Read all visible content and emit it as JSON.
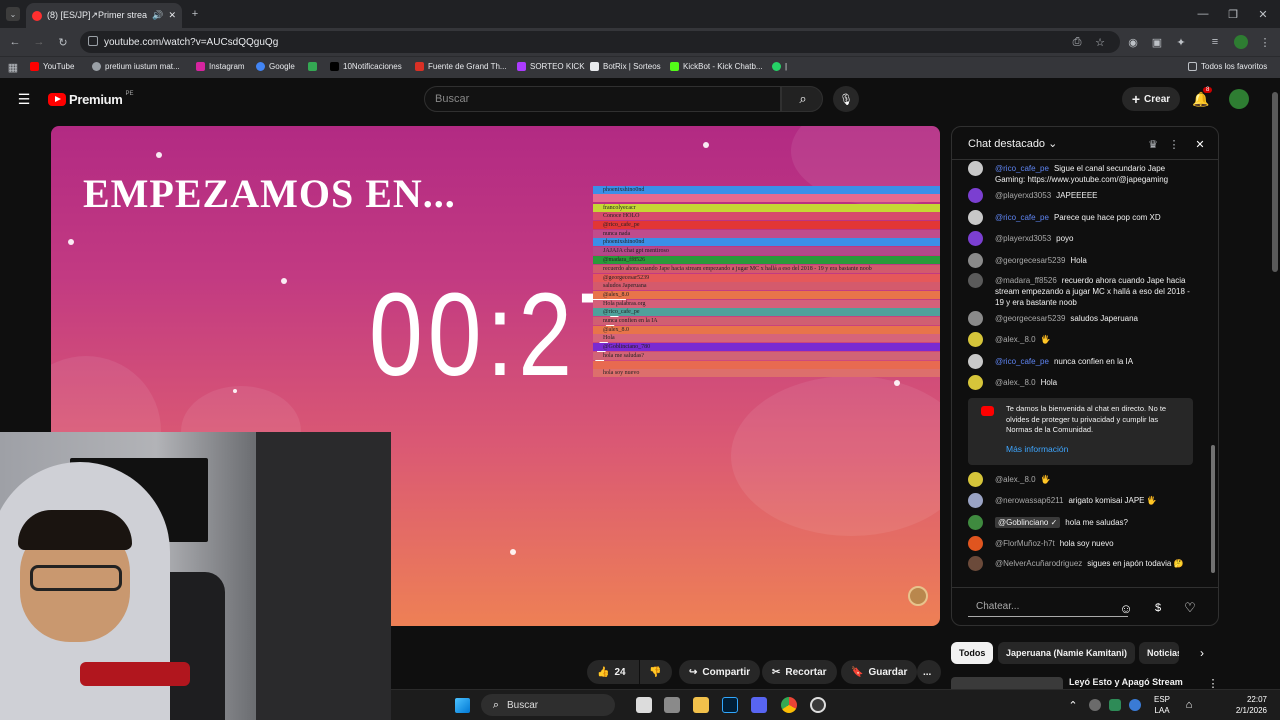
{
  "browser": {
    "tab_title": "(8) [ES/JP]↗Primer stream",
    "url": "youtube.com/watch?v=AUCsdQQguQg",
    "bookmarks": [
      {
        "label": "YouTube",
        "color": "#ff0000"
      },
      {
        "label": "pretium iustum mat...",
        "color": "#9aa0a6"
      },
      {
        "label": "Instagram",
        "color": "#d6249f"
      },
      {
        "label": "Google",
        "color": "#4285f4"
      },
      {
        "label": "",
        "color": "#34a853"
      },
      {
        "label": "10Notificaciones",
        "color": "#000000"
      },
      {
        "label": "Fuente de Grand Th...",
        "color": "#d93025"
      },
      {
        "label": "SORTEO KICK",
        "color": "#ac3bff"
      },
      {
        "label": "BotRix | Sorteos",
        "color": "#e8eaed"
      },
      {
        "label": "KickBot - Kick Chatb...",
        "color": "#53fc18"
      },
      {
        "label": "|",
        "color": "#25d366"
      }
    ],
    "all_favorites": "Todos los favoritos"
  },
  "youtube": {
    "logo_text": "Premium",
    "logo_region": "PE",
    "search_placeholder": "Buscar",
    "create_label": "Crear",
    "notif_count": "8"
  },
  "video": {
    "headline": "EMPEZAMOS EN...",
    "timer": "00:27",
    "overlay_lines": [
      {
        "text": "phoenixshino0nd",
        "color": "#3b8fe8"
      },
      {
        "text": "",
        "color": "#e66a8f"
      },
      {
        "text": "francolyecacr",
        "color": "#c6d734"
      },
      {
        "text": "Conoce HOLO",
        "color": "#d74a6c"
      },
      {
        "text": "@rico_cafe_pe",
        "color": "#e23636"
      },
      {
        "text": "nunca nada",
        "color": "#c04c8c"
      },
      {
        "text": "phoenixshino0nd",
        "color": "#3b8fe8"
      },
      {
        "text": "JAJAJA chat gpt mentiroso",
        "color": "#b4488a"
      },
      {
        "text": "@madara_ff8526",
        "color": "#2a9a3a"
      },
      {
        "text": "recuerdo ahora cuando Jape hacia stream empezando a jugar MC x hallá a eso del 2018 - 19 y era bastante noob",
        "color": "#d25a6d"
      },
      {
        "text": "@georgecesar5239",
        "color": "#e5585a"
      },
      {
        "text": "saludos Japeruana",
        "color": "#d45a6c"
      },
      {
        "text": "@alex_8.0",
        "color": "#e8744a"
      },
      {
        "text": "Hola palabras.org",
        "color": "#d4607a"
      },
      {
        "text": "@rico_cafe_pe",
        "color": "#4fa19b"
      },
      {
        "text": "nunca confien en la IA",
        "color": "#d05f72"
      },
      {
        "text": "@alex_8.0",
        "color": "#e8744a"
      },
      {
        "text": "Hola",
        "color": "#d6647a"
      },
      {
        "text": "@Goblinciano_780",
        "color": "#7a2ad1"
      },
      {
        "text": "hola me saludas?",
        "color": "#d16476"
      },
      {
        "text": "",
        "color": "#e86a50"
      },
      {
        "text": "hola soy nuevo",
        "color": "#dd6f6c"
      }
    ]
  },
  "actions": {
    "likes": "24",
    "share": "Compartir",
    "clip": "Recortar",
    "save": "Guardar",
    "more": "..."
  },
  "chat": {
    "title": "Chat destacado",
    "messages": [
      {
        "author": "@rico_cafe_pe",
        "role": "mod",
        "text": "Sigue el canal secundario Jape Gaming: https://www.youtube.com/@japegaming",
        "avatar": "#c8c8c8"
      },
      {
        "author": "@playerxd3053",
        "role": "",
        "text": "JAPEEEEE",
        "avatar": "#7b3fd1"
      },
      {
        "author": "@rico_cafe_pe",
        "role": "mod",
        "text": "Parece que hace pop com XD",
        "avatar": "#c8c8c8"
      },
      {
        "author": "@playerxd3053",
        "role": "",
        "text": "poyo",
        "avatar": "#7b3fd1"
      },
      {
        "author": "@georgecesar5239",
        "role": "",
        "text": "Hola",
        "avatar": "#8a8a8a"
      },
      {
        "author": "@madara_ff8526",
        "role": "",
        "text": "recuerdo ahora cuando Jape hacia stream empezando a jugar MC x hallá a eso del 2018 - 19 y era bastante noob",
        "avatar": "#5a5a5a"
      },
      {
        "author": "@georgecesar5239",
        "role": "",
        "text": "saludos Japeruana",
        "avatar": "#8a8a8a"
      },
      {
        "author": "@alex._8.0",
        "role": "",
        "text": "🖐",
        "avatar": "#d6c53a"
      },
      {
        "author": "@rico_cafe_pe",
        "role": "mod",
        "text": "nunca confien en la IA",
        "avatar": "#c8c8c8"
      },
      {
        "author": "@alex._8.0",
        "role": "",
        "text": "Hola",
        "avatar": "#d6c53a"
      }
    ],
    "welcome": "Te damos la bienvenida al chat en directo. No te olvides de proteger tu privacidad y cumplir las Normas de la Comunidad.",
    "welcome_link": "Más información",
    "messages2": [
      {
        "author": "@alex._8.0",
        "role": "",
        "text": "🖐",
        "avatar": "#d6c53a"
      },
      {
        "author": "@nerowassap6211",
        "role": "",
        "text": "arigato komisai JAPE 🖐",
        "avatar": "#9aa3c4"
      },
      {
        "author": "@Goblinciano ✓",
        "role": "mem",
        "text": "hola me saludas?",
        "avatar": "#3f8a3f"
      },
      {
        "author": "@FlorMuñoz-h7t",
        "role": "",
        "text": "hola soy nuevo",
        "avatar": "#e0551f"
      },
      {
        "author": "@NelverAcuñarodriguez",
        "role": "",
        "text": "sigues en japón todavia 🤔",
        "avatar": "#6b4a3a"
      }
    ],
    "input_placeholder": "Chatear..."
  },
  "chips": [
    "Todos",
    "Japeruana (Namie Kamitani)",
    "Noticias"
  ],
  "related_title": "Leyó Esto y Apagó Stream",
  "taskbar": {
    "search": "Buscar",
    "lang1": "ESP",
    "lang2": "LAA",
    "time": "22:07",
    "date": "2/1/2026"
  }
}
